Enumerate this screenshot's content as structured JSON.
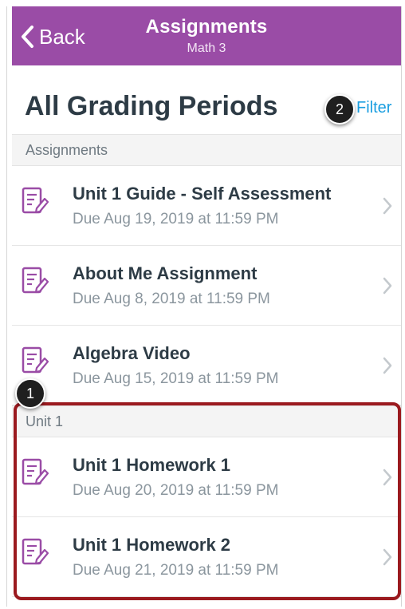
{
  "nav": {
    "back_label": "Back",
    "title": "Assignments",
    "subtitle": "Math 3"
  },
  "header": {
    "title": "All Grading Periods",
    "filter_label": "Filter"
  },
  "callouts": [
    "1",
    "2"
  ],
  "sections": [
    {
      "label": "Assignments",
      "items": [
        {
          "title": "Unit 1 Guide - Self Assessment",
          "due": "Due Aug 19, 2019 at 11:59 PM"
        },
        {
          "title": "About Me Assignment",
          "due": "Due Aug 8, 2019 at 11:59 PM"
        },
        {
          "title": "Algebra Video",
          "due": "Due Aug 15, 2019 at 11:59 PM"
        }
      ]
    },
    {
      "label": "Unit 1",
      "items": [
        {
          "title": "Unit 1 Homework 1",
          "due": "Due Aug 20, 2019 at 11:59 PM"
        },
        {
          "title": "Unit 1 Homework 2",
          "due": "Due Aug 21, 2019 at 11:59 PM"
        }
      ]
    }
  ],
  "colors": {
    "nav_bg": "#9a4ca6",
    "accent_link": "#1a9ee0",
    "assignment_icon": "#9a4ca6",
    "highlight_border": "#9b1a1f"
  },
  "icons": {
    "back": "chevron-left-icon",
    "assignment": "assignment-edit-icon",
    "row_disclosure": "chevron-right-icon"
  }
}
